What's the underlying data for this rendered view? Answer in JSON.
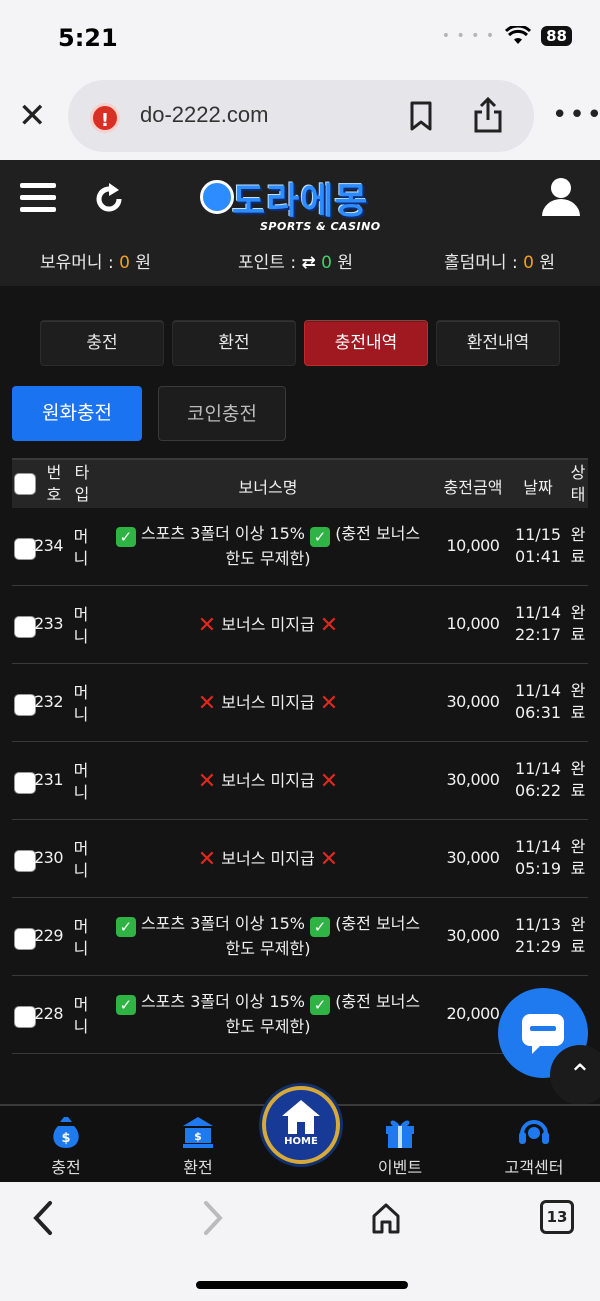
{
  "status_bar": {
    "time": "5:21",
    "battery": "88"
  },
  "browser": {
    "url": "do-2222.com",
    "tabs_count": "13"
  },
  "header": {
    "logo_text": "도라에몽",
    "logo_sub": "SPORTS & CASINO",
    "balances": [
      {
        "label": "보유머니 : ",
        "value": "0",
        "unit": " 원"
      },
      {
        "label": "포인트 : ",
        "value": "0",
        "unit": " 원"
      },
      {
        "label": "홀덤머니 : ",
        "value": "0",
        "unit": " 원"
      }
    ]
  },
  "tabs": [
    "충전",
    "환전",
    "충전내역",
    "환전내역"
  ],
  "active_tab": "충전내역",
  "subtabs": [
    "원화충전",
    "코인충전"
  ],
  "table": {
    "headers": {
      "no": "번호",
      "type": "타입",
      "bonus": "보너스명",
      "amount": "충전금액",
      "date": "날짜",
      "status": "상태"
    },
    "rows": [
      {
        "no": "234",
        "type": "머니",
        "bonus_ok": true,
        "bonus_text": "스포츠 3폴더 이상 15%",
        "bonus_tail": "(충전 보너스",
        "bonus_line2": "한도 무제한)",
        "amount": "10,000",
        "date": "11/15",
        "time": "01:41",
        "status": "완료"
      },
      {
        "no": "233",
        "type": "머니",
        "bonus_ok": false,
        "bonus_text": "보너스 미지급",
        "amount": "10,000",
        "date": "11/14",
        "time": "22:17",
        "status": "완료"
      },
      {
        "no": "232",
        "type": "머니",
        "bonus_ok": false,
        "bonus_text": "보너스 미지급",
        "amount": "30,000",
        "date": "11/14",
        "time": "06:31",
        "status": "완료"
      },
      {
        "no": "231",
        "type": "머니",
        "bonus_ok": false,
        "bonus_text": "보너스 미지급",
        "amount": "30,000",
        "date": "11/14",
        "time": "06:22",
        "status": "완료"
      },
      {
        "no": "230",
        "type": "머니",
        "bonus_ok": false,
        "bonus_text": "보너스 미지급",
        "amount": "30,000",
        "date": "11/14",
        "time": "05:19",
        "status": "완료"
      },
      {
        "no": "229",
        "type": "머니",
        "bonus_ok": true,
        "bonus_text": "스포츠 3폴더 이상 15%",
        "bonus_tail": "(충전 보너스",
        "bonus_line2": "한도 무제한)",
        "amount": "30,000",
        "date": "11/13",
        "time": "21:29",
        "status": "완료"
      },
      {
        "no": "228",
        "type": "머니",
        "bonus_ok": true,
        "bonus_text": "스포츠 3폴더 이상 15%",
        "bonus_tail": "(충전 보너스",
        "bonus_line2": "한도 무제한)",
        "amount": "20,000",
        "date": "",
        "time": "",
        "status": ""
      }
    ]
  },
  "bottom_nav": [
    {
      "label": "충전",
      "icon": "money-bag-icon"
    },
    {
      "label": "환전",
      "icon": "bank-icon"
    },
    {
      "label": "HOME",
      "icon": "home-icon"
    },
    {
      "label": "이벤트",
      "icon": "gift-icon"
    },
    {
      "label": "고객센터",
      "icon": "headset-icon"
    }
  ],
  "colors": {
    "accent_red": "#a01820",
    "primary_blue": "#1a73f0",
    "money_orange": "#f0a020"
  }
}
